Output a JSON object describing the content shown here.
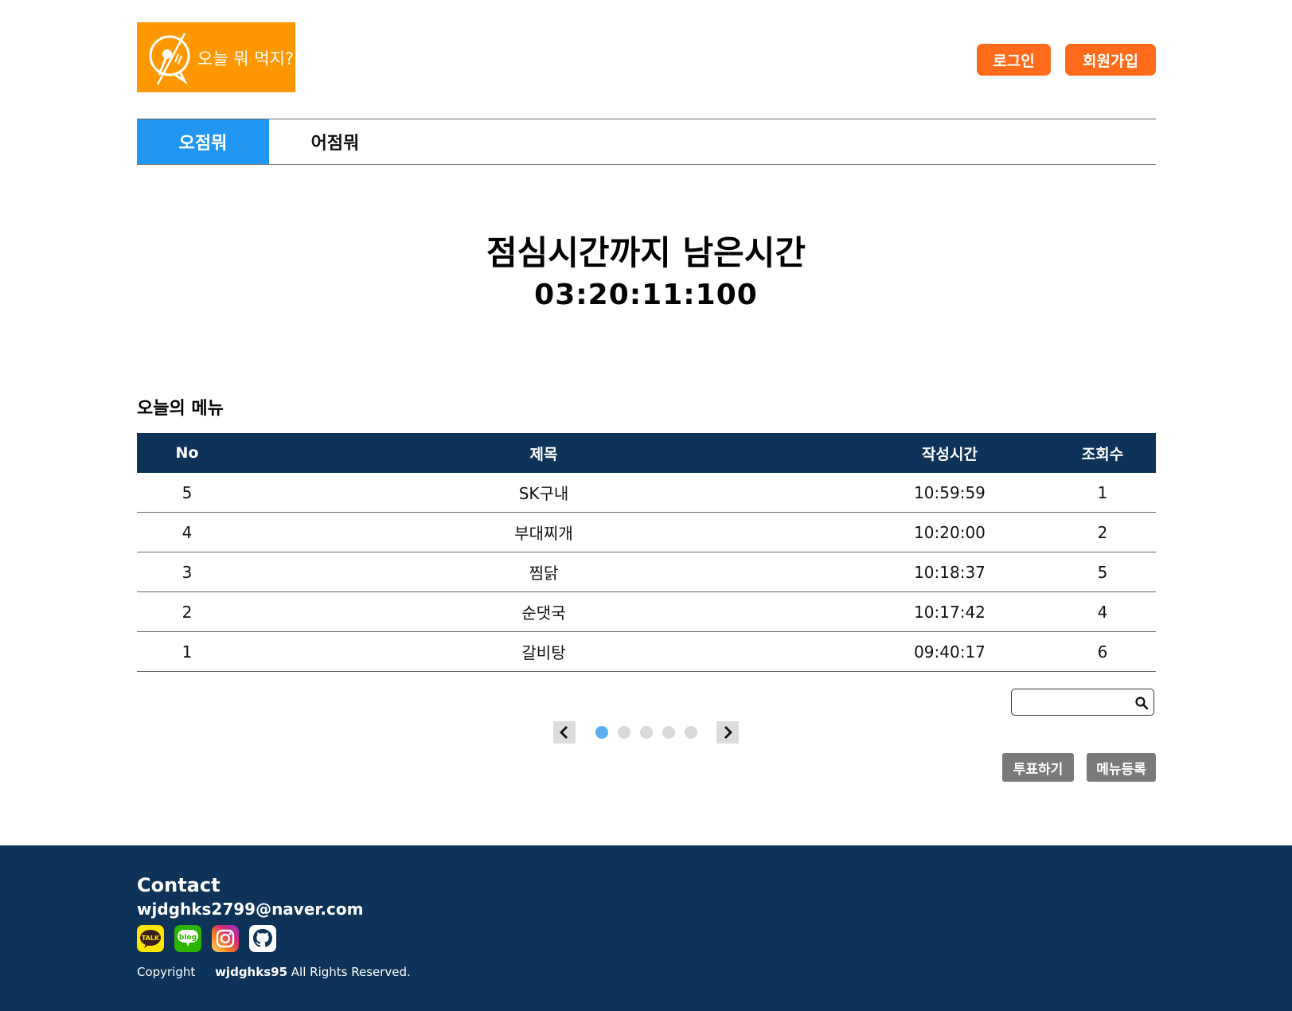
{
  "header": {
    "logo_text": "오늘 뭐 먹지?",
    "login_label": "로그인",
    "signup_label": "회원가입"
  },
  "tabs": [
    {
      "label": "오점뭐",
      "active": true
    },
    {
      "label": "어점뭐",
      "active": false
    }
  ],
  "countdown": {
    "title": "점심시간까지 남은시간",
    "time": "03:20:11:100"
  },
  "menu": {
    "section_title": "오늘의 메뉴",
    "columns": [
      "No",
      "제목",
      "작성시간",
      "조회수"
    ],
    "rows": [
      {
        "no": "5",
        "title": "SK구내",
        "time": "10:59:59",
        "views": "1"
      },
      {
        "no": "4",
        "title": "부대찌개",
        "time": "10:20:00",
        "views": "2"
      },
      {
        "no": "3",
        "title": "찜닭",
        "time": "10:18:37",
        "views": "5"
      },
      {
        "no": "2",
        "title": "순댓국",
        "time": "10:17:42",
        "views": "4"
      },
      {
        "no": "1",
        "title": "갈비탕",
        "time": "09:40:17",
        "views": "6"
      }
    ]
  },
  "search": {
    "value": "",
    "placeholder": ""
  },
  "pagination": {
    "pages": 5,
    "current": 1
  },
  "actions": {
    "vote_label": "투표하기",
    "register_label": "메뉴등록"
  },
  "footer": {
    "contact_title": "Contact",
    "email": "wjdghks2799@naver.com",
    "socials": [
      {
        "icon": "kakaotalk-icon",
        "label": "TALK"
      },
      {
        "icon": "blog-icon",
        "label": "blog"
      },
      {
        "icon": "instagram-icon"
      },
      {
        "icon": "github-icon"
      }
    ],
    "copyright_prefix": "Copyright",
    "copyright_owner": "wjdghks95",
    "copyright_suffix": "All Rights Reserved."
  },
  "colors": {
    "logo_bg": "#ff9800",
    "auth_button": "#ff6b1a",
    "tab_active": "#2196f3",
    "table_header": "#0d3358",
    "footer_bg": "#0d3358",
    "page_dot_active": "#5aaef2",
    "page_dot": "#d9d9d9",
    "action_button": "#7a7a7a"
  }
}
